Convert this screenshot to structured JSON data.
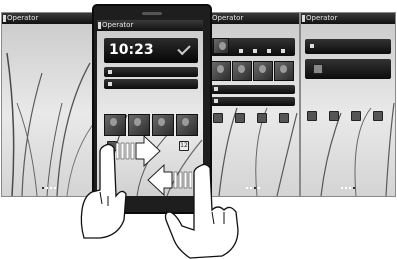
{
  "panels": [
    {
      "operator": "Operator"
    },
    {
      "operator": "Operator"
    },
    {
      "operator": "Operator"
    },
    {
      "operator": "Operator"
    }
  ],
  "phone": {
    "operator": "Operator",
    "clock": "10:23"
  },
  "calendar_badge": "12"
}
